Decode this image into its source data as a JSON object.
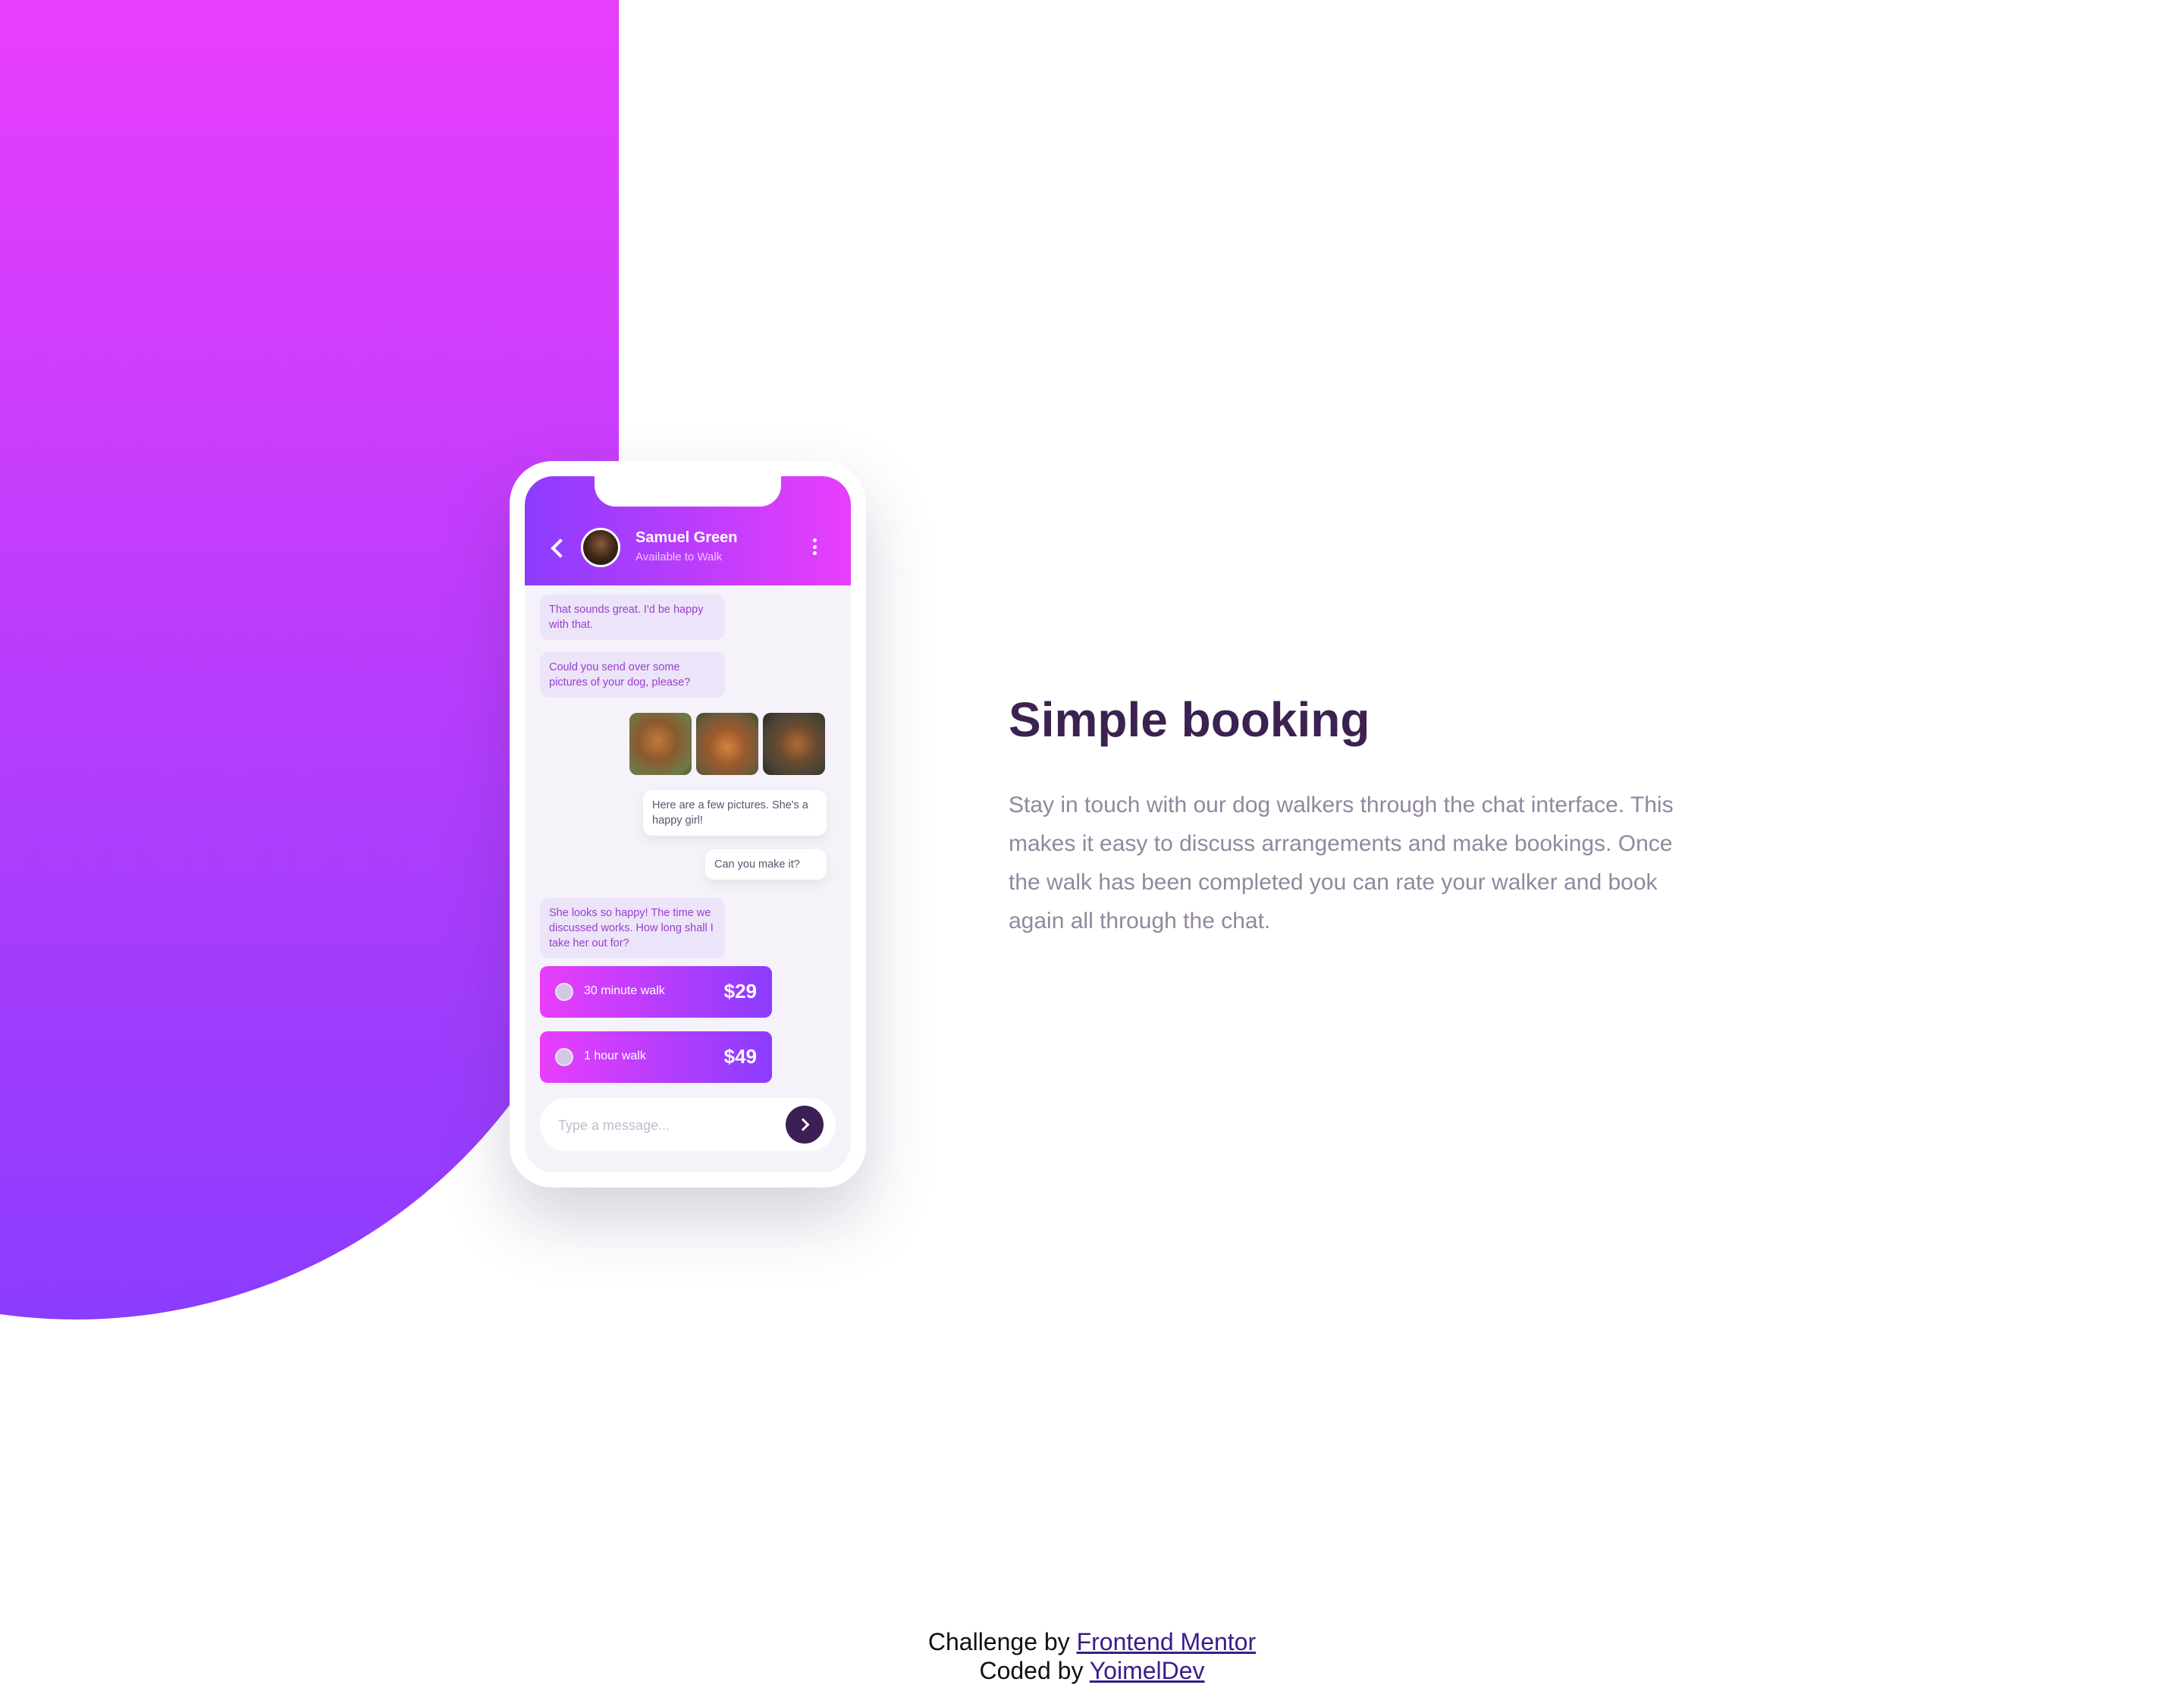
{
  "colors": {
    "gradient_start": "#e83efc",
    "gradient_end": "#8b3cfd",
    "heading": "#3b2250",
    "body_text": "#92889e",
    "send_button": "#3c1f55"
  },
  "chat": {
    "contact_name": "Samuel Green",
    "contact_status": "Available to Walk",
    "messages": [
      {
        "from": "walker",
        "text": "That sounds great. I'd be happy with that."
      },
      {
        "from": "walker",
        "text": "Could you send over some pictures of your dog, please?"
      },
      {
        "from": "user",
        "text": "Here are a few pictures. She's a happy girl!"
      },
      {
        "from": "user",
        "text": "Can you make it?"
      },
      {
        "from": "walker",
        "text": "She looks so happy! The time we discussed works. How long shall I take her out for?"
      }
    ],
    "options": [
      {
        "label": "30 minute walk",
        "price": "$29"
      },
      {
        "label": "1 hour walk",
        "price": "$49"
      }
    ],
    "input_placeholder": "Type a message..."
  },
  "content": {
    "title": "Simple booking",
    "description": "Stay in touch with our dog walkers through the chat interface. This makes it easy to discuss arrangements and make bookings. Once the walk has been completed you can rate your walker and book again all through the chat."
  },
  "footer": {
    "challenge_prefix": "Challenge by",
    "challenge_link": "Frontend Mentor",
    "coded_prefix": "Coded by",
    "coded_link": "YoimelDev"
  }
}
